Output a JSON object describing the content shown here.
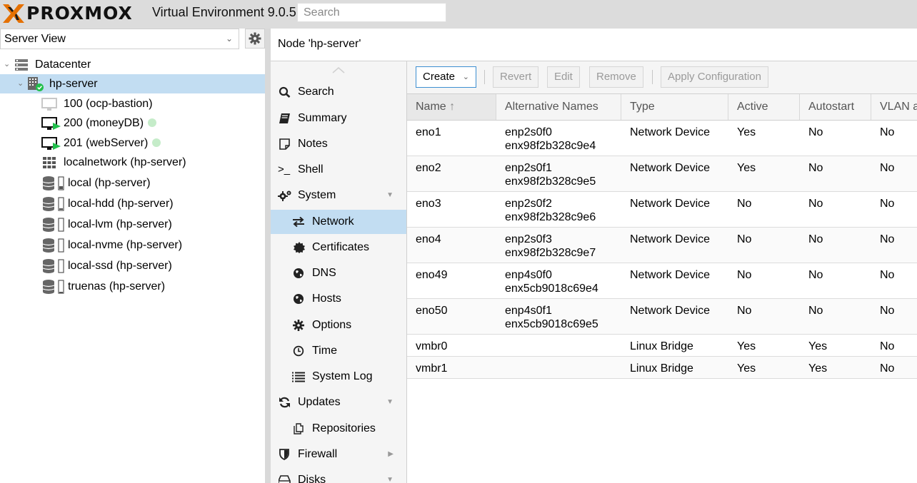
{
  "topbar": {
    "brand": "PROXMOX",
    "version_text": "Virtual Environment 9.0.5",
    "search_placeholder": "Search"
  },
  "left_panel": {
    "view_selector": "Server View",
    "tree": [
      {
        "label": "Datacenter",
        "icon": "datacenter-icon",
        "level": 0
      },
      {
        "label": "hp-server",
        "icon": "server-node-icon",
        "level": 1,
        "selected": true
      },
      {
        "label": "100 (ocp-bastion)",
        "icon": "vm-stopped-icon",
        "level": 2
      },
      {
        "label": "200 (moneyDB)",
        "icon": "vm-running-icon",
        "level": 2,
        "status_dot": true
      },
      {
        "label": "201 (webServer)",
        "icon": "vm-running-icon",
        "level": 2,
        "status_dot": true
      },
      {
        "label": "localnetwork (hp-server)",
        "icon": "sdn-grid-icon",
        "level": 2
      },
      {
        "label": "local (hp-server)",
        "icon": "storage-icon",
        "level": 2
      },
      {
        "label": "local-hdd (hp-server)",
        "icon": "storage-icon",
        "level": 2
      },
      {
        "label": "local-lvm (hp-server)",
        "icon": "storage-icon",
        "level": 2
      },
      {
        "label": "local-nvme (hp-server)",
        "icon": "storage-icon",
        "level": 2
      },
      {
        "label": "local-ssd (hp-server)",
        "icon": "storage-icon",
        "level": 2
      },
      {
        "label": "truenas (hp-server)",
        "icon": "storage-icon",
        "level": 2
      }
    ]
  },
  "main": {
    "title": "Node 'hp-server'",
    "nav": [
      {
        "label": "Search",
        "icon": "search-icon",
        "indent": false
      },
      {
        "label": "Summary",
        "icon": "book-icon",
        "indent": false
      },
      {
        "label": "Notes",
        "icon": "note-icon",
        "indent": false
      },
      {
        "label": "Shell",
        "icon": "terminal-icon",
        "indent": false
      },
      {
        "label": "System",
        "icon": "cogs-icon",
        "indent": false,
        "expandable": "down"
      },
      {
        "label": "Network",
        "icon": "exchange-icon",
        "indent": true,
        "selected": true
      },
      {
        "label": "Certificates",
        "icon": "certificate-icon",
        "indent": true
      },
      {
        "label": "DNS",
        "icon": "globe-icon",
        "indent": true
      },
      {
        "label": "Hosts",
        "icon": "globe-icon",
        "indent": true
      },
      {
        "label": "Options",
        "icon": "gear-icon",
        "indent": true
      },
      {
        "label": "Time",
        "icon": "clock-icon",
        "indent": true
      },
      {
        "label": "System Log",
        "icon": "list-icon",
        "indent": true
      },
      {
        "label": "Updates",
        "icon": "refresh-icon",
        "indent": false,
        "expandable": "down"
      },
      {
        "label": "Repositories",
        "icon": "files-icon",
        "indent": true
      },
      {
        "label": "Firewall",
        "icon": "shield-icon",
        "indent": false,
        "expandable": "right"
      },
      {
        "label": "Disks",
        "icon": "hdd-icon",
        "indent": false,
        "expandable": "down"
      }
    ],
    "toolbar": {
      "create": "Create",
      "revert": "Revert",
      "edit": "Edit",
      "remove": "Remove",
      "apply": "Apply Configuration"
    },
    "grid": {
      "columns": [
        "Name",
        "Alternative Names",
        "Type",
        "Active",
        "Autostart",
        "VLAN a"
      ],
      "sort_indicator": "↑",
      "rows": [
        {
          "name": "eno1",
          "alt1": "enp2s0f0",
          "alt2": "enx98f2b328c9e4",
          "type": "Network Device",
          "active": "Yes",
          "autostart": "No",
          "vlan": "No"
        },
        {
          "name": "eno2",
          "alt1": "enp2s0f1",
          "alt2": "enx98f2b328c9e5",
          "type": "Network Device",
          "active": "Yes",
          "autostart": "No",
          "vlan": "No"
        },
        {
          "name": "eno3",
          "alt1": "enp2s0f2",
          "alt2": "enx98f2b328c9e6",
          "type": "Network Device",
          "active": "No",
          "autostart": "No",
          "vlan": "No"
        },
        {
          "name": "eno4",
          "alt1": "enp2s0f3",
          "alt2": "enx98f2b328c9e7",
          "type": "Network Device",
          "active": "No",
          "autostart": "No",
          "vlan": "No"
        },
        {
          "name": "eno49",
          "alt1": "enp4s0f0",
          "alt2": "enx5cb9018c69e4",
          "type": "Network Device",
          "active": "No",
          "autostart": "No",
          "vlan": "No"
        },
        {
          "name": "eno50",
          "alt1": "enp4s0f1",
          "alt2": "enx5cb9018c69e5",
          "type": "Network Device",
          "active": "No",
          "autostart": "No",
          "vlan": "No"
        },
        {
          "name": "vmbr0",
          "alt1": "",
          "alt2": "",
          "type": "Linux Bridge",
          "active": "Yes",
          "autostart": "Yes",
          "vlan": "No"
        },
        {
          "name": "vmbr1",
          "alt1": "",
          "alt2": "",
          "type": "Linux Bridge",
          "active": "Yes",
          "autostart": "Yes",
          "vlan": "No"
        }
      ]
    }
  },
  "colors": {
    "topbar_bg": "#dcdcdc",
    "selection": "#c2ddf2",
    "brand_orange": "#e57000",
    "running_green": "#21bf4b",
    "status_dot": "#c5ecc9"
  }
}
